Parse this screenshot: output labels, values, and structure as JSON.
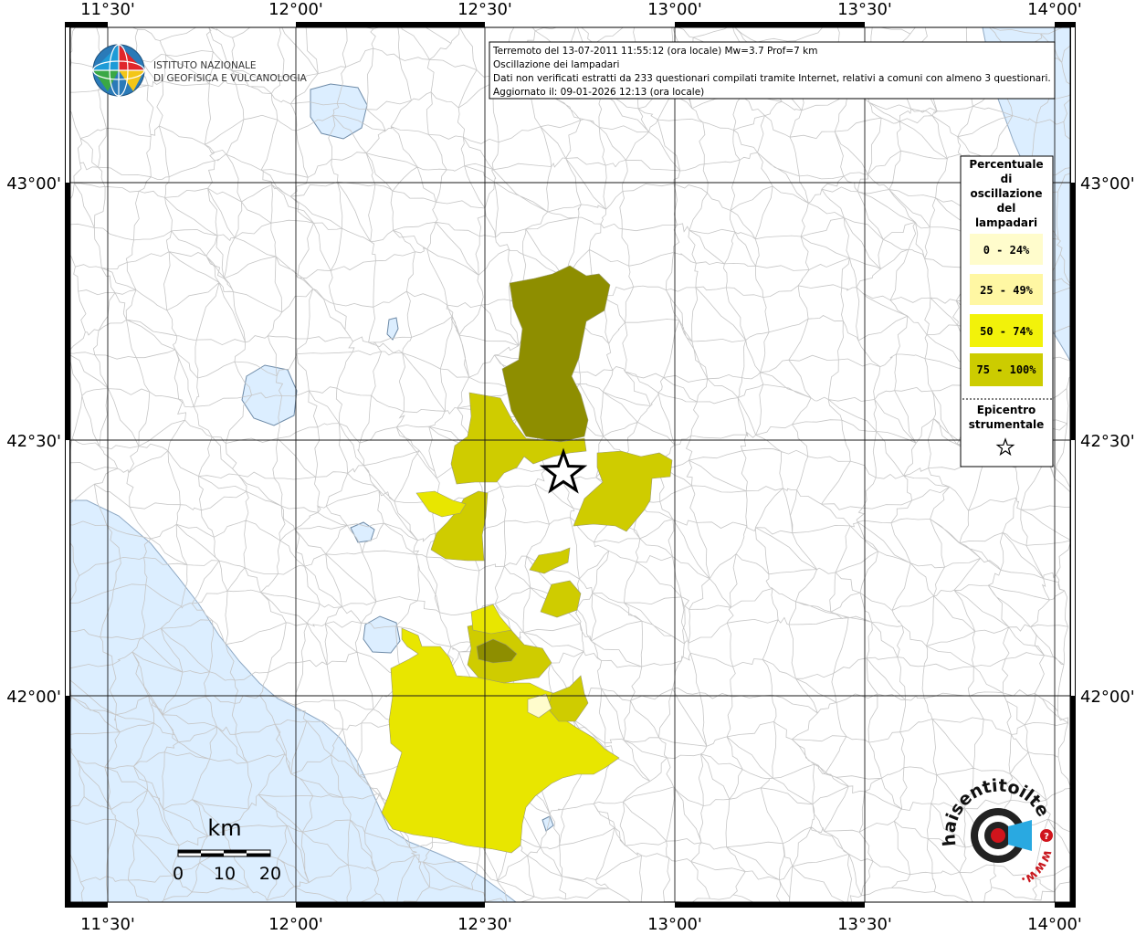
{
  "header": {
    "lines": [
      "Terremoto del 13-07-2011 11:55:12 (ora locale) Mw=3.7 Prof=7 km",
      "Oscillazione dei lampadari",
      "Dati non verificati estratti da 233 questionari compilati tramite Internet, relativi a comuni con almeno 3 questionari.",
      "Aggiornato il: 09-01-2026 12:13 (ora locale)"
    ]
  },
  "logo": {
    "line1": "ISTITUTO NAZIONALE",
    "line2": "DI GEOFISICA E VULCANOLOGIA"
  },
  "axes": {
    "lon_ticks": [
      "11°30'",
      "12°00'",
      "12°30'",
      "13°00'",
      "13°30'",
      "14°00'"
    ],
    "lat_ticks": [
      "43°00'",
      "42°30'",
      "42°00'"
    ]
  },
  "legend": {
    "title_lines": [
      "Percentuale",
      "di",
      "oscillazione",
      "del",
      "lampadari"
    ],
    "classes": [
      {
        "label": "0 - 24%",
        "color": "#fffccc"
      },
      {
        "label": "25 - 49%",
        "color": "#fff7a3"
      },
      {
        "label": "50 - 74%",
        "color": "#f2f20a"
      },
      {
        "label": "75 - 100%",
        "color": "#cccc00"
      }
    ],
    "epicenter_lines": [
      "Epicentro",
      "strumentale"
    ]
  },
  "colors": {
    "sea": "#dceeff",
    "class_75_100_map": "#8e8e00",
    "class_50_74_map": "#cfcc00",
    "class_25_49_map": "#e8e600",
    "class_0_24_map": "#fffccc"
  },
  "scale_bar": {
    "unit": "km",
    "labels": [
      "0",
      "10",
      "20"
    ]
  },
  "watermark": {
    "text": "haisentitoilterremoto.it",
    "url": "www."
  }
}
